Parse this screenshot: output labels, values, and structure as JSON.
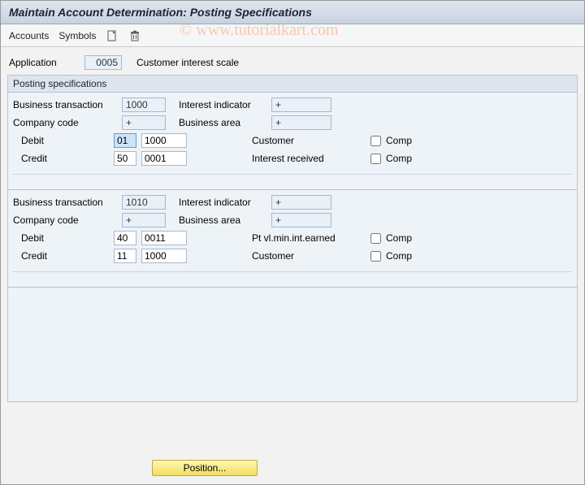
{
  "watermark": "© www.tutorialkart.com",
  "title": "Maintain Account Determination: Posting Specifications",
  "toolbar": {
    "accounts": "Accounts",
    "symbols": "Symbols"
  },
  "application": {
    "label": "Application",
    "value": "0005",
    "desc": "Customer interest scale"
  },
  "group_title": "Posting specifications",
  "labels": {
    "business_transaction": "Business transaction",
    "interest_indicator": "Interest indicator",
    "company_code": "Company code",
    "business_area": "Business area",
    "debit": "Debit",
    "credit": "Credit",
    "comp": "Comp"
  },
  "blocks": [
    {
      "business_transaction": "1000",
      "interest_indicator": "+",
      "company_code": "+",
      "business_area": "+",
      "debit": {
        "key": "01",
        "acct": "1000",
        "desc": "Customer",
        "comp": false
      },
      "credit": {
        "key": "50",
        "acct": "0001",
        "desc": "Interest received",
        "comp": false
      }
    },
    {
      "business_transaction": "1010",
      "interest_indicator": "+",
      "company_code": "+",
      "business_area": "+",
      "debit": {
        "key": "40",
        "acct": "0011",
        "desc": "Pt vl.min.int.earned",
        "comp": false
      },
      "credit": {
        "key": "11",
        "acct": "1000",
        "desc": "Customer",
        "comp": false
      }
    }
  ],
  "position_button": "Position..."
}
